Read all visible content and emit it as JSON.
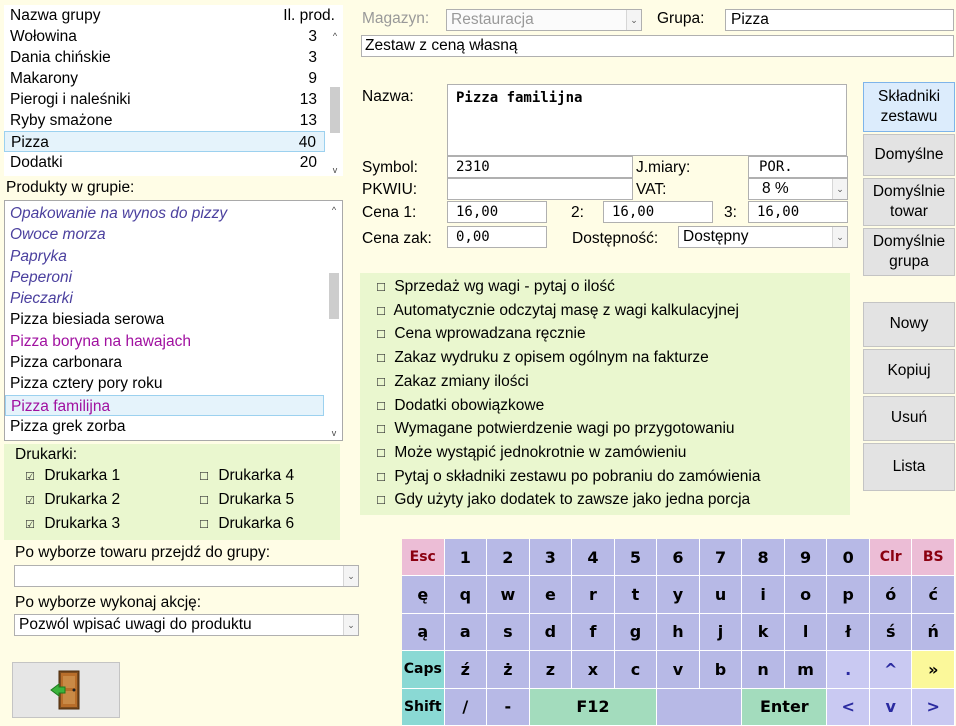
{
  "groups": {
    "header_name": "Nazwa grupy",
    "header_count": "Il. prod.",
    "rows": [
      {
        "name": "Wołowina",
        "count": "3"
      },
      {
        "name": "Dania chińskie",
        "count": "3"
      },
      {
        "name": "Makarony",
        "count": "9"
      },
      {
        "name": "Pierogi i naleśniki",
        "count": "13"
      },
      {
        "name": "Ryby smażone",
        "count": "13"
      },
      {
        "name": "Pizza",
        "count": "40"
      },
      {
        "name": "Dodatki",
        "count": "20"
      }
    ]
  },
  "products": {
    "label": "Produkty w grupie:",
    "items": [
      {
        "name": "Opakowanie na wynos do pizzy",
        "style": "it"
      },
      {
        "name": "Owoce morza",
        "style": "it"
      },
      {
        "name": "Papryka",
        "style": "it"
      },
      {
        "name": "Peperoni",
        "style": "it"
      },
      {
        "name": "Pieczarki",
        "style": "it"
      },
      {
        "name": "Pizza biesiada serowa",
        "style": ""
      },
      {
        "name": "Pizza boryna na hawajach",
        "style": "pk"
      },
      {
        "name": "Pizza carbonara",
        "style": ""
      },
      {
        "name": "Pizza cztery pory roku",
        "style": ""
      },
      {
        "name": "Pizza familijna",
        "style": "pk psel"
      },
      {
        "name": "Pizza grek zorba",
        "style": ""
      }
    ]
  },
  "printers": {
    "label": "Drukarki:",
    "items": [
      {
        "label": "Drukarka 1",
        "checked": true
      },
      {
        "label": "Drukarka 4",
        "checked": false
      },
      {
        "label": "Drukarka 2",
        "checked": true
      },
      {
        "label": "Drukarka 5",
        "checked": false
      },
      {
        "label": "Drukarka 3",
        "checked": true
      },
      {
        "label": "Drukarka 6",
        "checked": false
      }
    ]
  },
  "goto_group": {
    "label": "Po wyborze towaru przejdź do grupy:",
    "value": ""
  },
  "action": {
    "label": "Po wyborze wykonaj akcję:",
    "value": "Pozwól wpisać uwagi do produktu"
  },
  "form": {
    "magazyn_label": "Magazyn:",
    "magazyn_value": "Restauracja",
    "grupa_label": "Grupa:",
    "grupa_value": "Pizza",
    "type_value": "Zestaw z ceną własną",
    "nazwa_label": "Nazwa:",
    "nazwa_value": "Pizza familijna",
    "symbol_label": "Symbol:",
    "symbol_value": "2310",
    "jm_label": "J.miary:",
    "jm_value": "POR.",
    "pkwiu_label": "PKWIU:",
    "pkwiu_value": "",
    "vat_label": "VAT:",
    "vat_value": "8 %",
    "cena1_label": "Cena 1:",
    "cena1_value": "16,00",
    "cena2_label": "2:",
    "cena2_value": "16,00",
    "cena3_label": "3:",
    "cena3_value": "16,00",
    "cenazak_label": "Cena zak:",
    "cenazak_value": "0,00",
    "dost_label": "Dostępność:",
    "dost_value": "Dostępny"
  },
  "options": [
    "Sprzedaż wg wagi - pytaj o ilość",
    "Automatycznie odczytaj masę z wagi kalkulacyjnej",
    "Cena wprowadzana ręcznie",
    "Zakaz wydruku z opisem ogólnym na fakturze",
    "Zakaz zmiany ilości",
    "Dodatki obowiązkowe",
    "Wymagane potwierdzenie wagi po przygotowaniu",
    "Może wystąpić jednokrotnie w zamówieniu",
    "Pytaj o składniki zestawu po pobraniu do zamówienia",
    "Gdy użyty jako dodatek to zawsze jako jedna porcja"
  ],
  "buttons": {
    "skladniki": "Składniki zestawu",
    "domyslne": "Domyślne",
    "domyslnie_towar": "Domyślnie towar",
    "domyslnie_grupa": "Domyślnie grupa",
    "nowy": "Nowy",
    "kopiuj": "Kopiuj",
    "usun": "Usuń",
    "lista": "Lista"
  },
  "keyboard": {
    "rows": [
      [
        "Esc",
        "1",
        "2",
        "3",
        "4",
        "5",
        "6",
        "7",
        "8",
        "9",
        "0",
        "Clr",
        "BS"
      ],
      [
        "ę",
        "q",
        "w",
        "e",
        "r",
        "t",
        "y",
        "u",
        "i",
        "o",
        "p",
        "ó",
        "ć"
      ],
      [
        "ą",
        "a",
        "s",
        "d",
        "f",
        "g",
        "h",
        "j",
        "k",
        "l",
        "ł",
        "ś",
        "ń"
      ],
      [
        "Caps",
        "ź",
        "ż",
        "z",
        "x",
        "c",
        "v",
        "b",
        "n",
        "m",
        ".",
        "^",
        "»"
      ],
      [
        "Shift",
        "/",
        "-",
        "F12",
        "Enter",
        "<",
        "v",
        ">"
      ]
    ]
  },
  "icons": {
    "exit": "exit-door-icon"
  }
}
